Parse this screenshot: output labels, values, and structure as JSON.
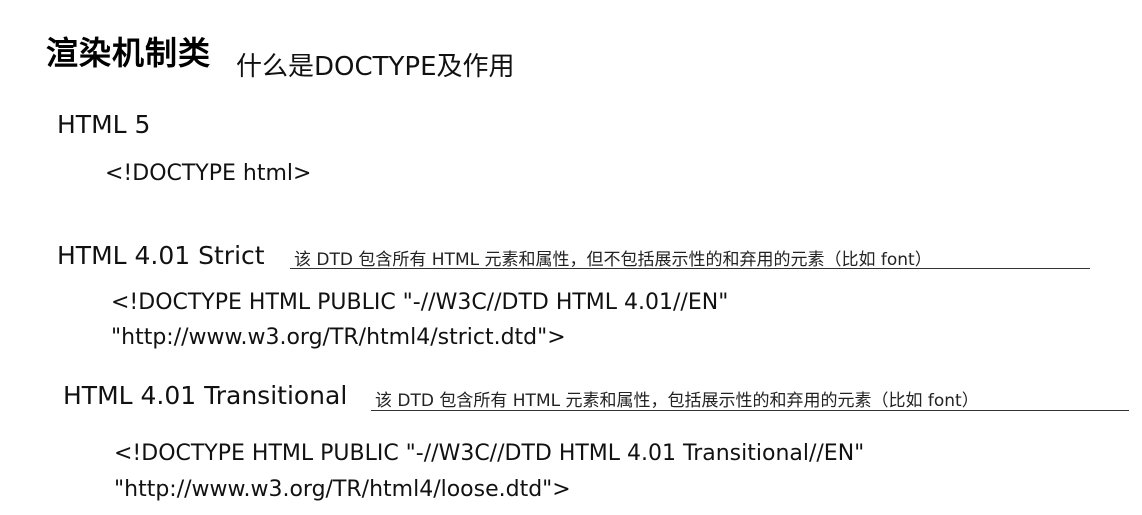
{
  "header": {
    "title": "渲染机制类",
    "subtitle": "什么是DOCTYPE及作用"
  },
  "sections": [
    {
      "label": "HTML 5",
      "note": "",
      "lines": [
        "<!DOCTYPE html>"
      ]
    },
    {
      "label": "HTML 4.01 Strict",
      "note": "该 DTD 包含所有 HTML 元素和属性，但不包括展示性的和弃用的元素（比如 font）",
      "lines": [
        "<!DOCTYPE HTML PUBLIC \"-//W3C//DTD HTML 4.01//EN\"",
        "\"http://www.w3.org/TR/html4/strict.dtd\">"
      ]
    },
    {
      "label": "HTML 4.01 Transitional",
      "note": "该 DTD 包含所有 HTML 元素和属性，包括展示性的和弃用的元素（比如 font）",
      "lines": [
        "<!DOCTYPE HTML PUBLIC \"-//W3C//DTD HTML 4.01 Transitional//EN\"",
        "\"http://www.w3.org/TR/html4/loose.dtd\">"
      ]
    }
  ]
}
